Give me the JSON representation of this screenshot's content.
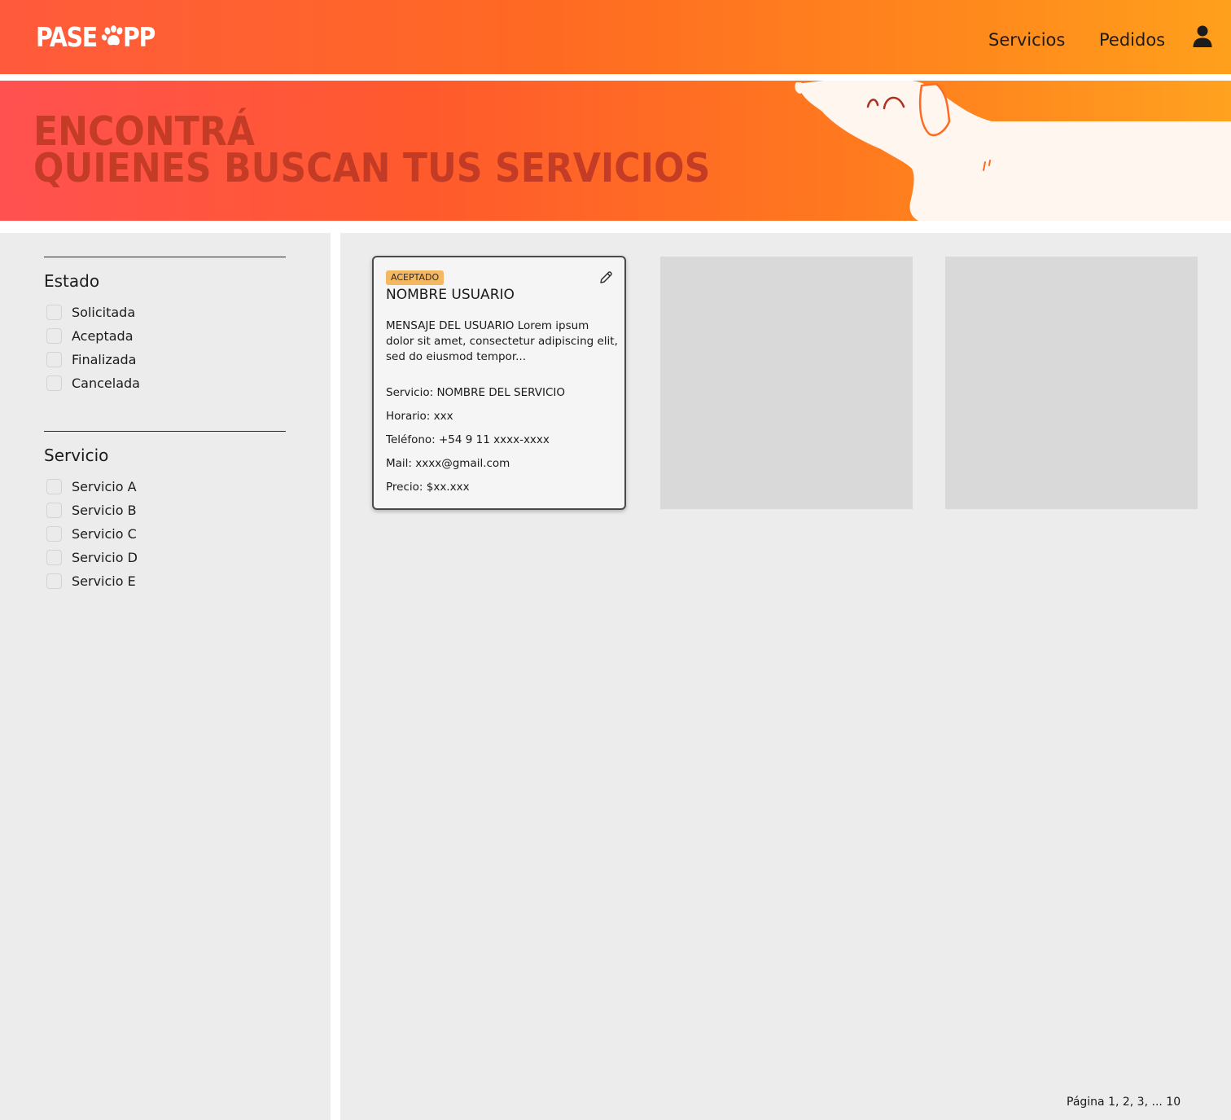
{
  "header": {
    "logo_text_left": "PASE",
    "logo_text_right": "PP",
    "nav": [
      {
        "label": "Servicios"
      },
      {
        "label": "Pedidos"
      }
    ],
    "brand_color": "#ff6a22",
    "user_icon": "user-icon"
  },
  "hero": {
    "title_line1": "ENCONTRÁ",
    "title_line2": "QUIENES BUSCAN TUS SERVICIOS"
  },
  "filters": {
    "estado": {
      "title": "Estado",
      "options": [
        "Solicitada",
        "Aceptada",
        "Finalizada",
        "Cancelada"
      ]
    },
    "servicio": {
      "title": "Servicio",
      "options": [
        "Servicio A",
        "Servicio B",
        "Servicio C",
        "Servicio D",
        "Servicio E"
      ]
    }
  },
  "cards": [
    {
      "status": "ACEPTADO",
      "status_color": "#f4b860",
      "name": "NOMBRE USUARIO",
      "message": "MENSAJE DEL USUARIO Lorem ipsum dolor sit amet, consectetur adipiscing elit, sed do eiusmod tempor...",
      "servicio": "Servicio: NOMBRE DEL SERVICIO",
      "horario": "Horario: xxx",
      "telefono": "Teléfono: +54 9 11 xxxx-xxxx",
      "mail": "Mail: xxxx@gmail.com",
      "precio": "Precio: $xx.xxx"
    }
  ],
  "pagination": {
    "label": "Página 1, 2, 3, ... 10"
  }
}
